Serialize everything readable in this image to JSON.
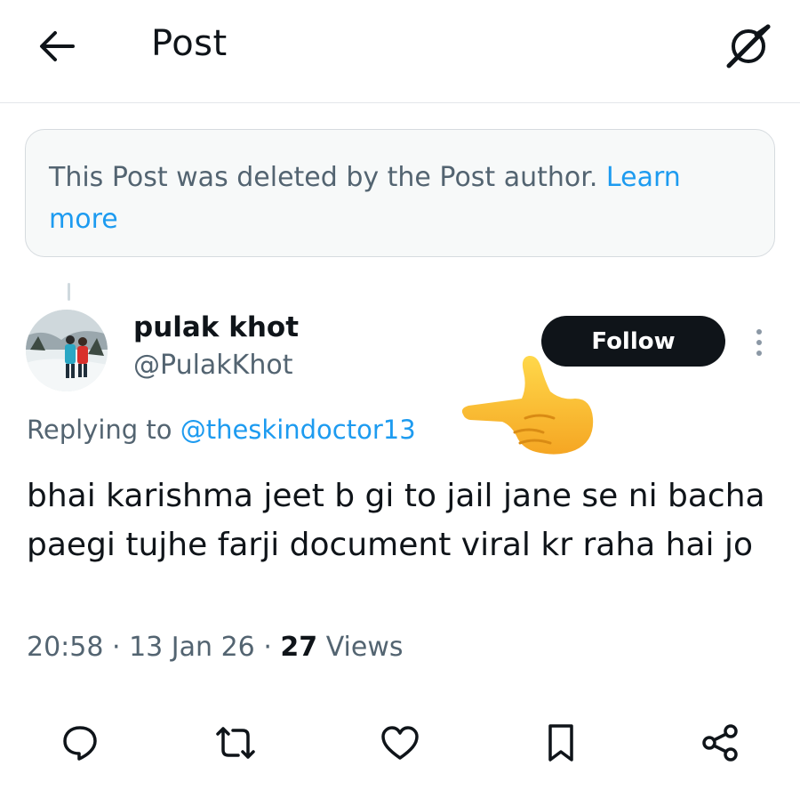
{
  "header": {
    "title": "Post",
    "back_icon": "arrow-left-icon",
    "grok_icon": "grok-icon"
  },
  "notice": {
    "text": "This Post was deleted by the Post author.",
    "link_text": "Learn more"
  },
  "post": {
    "author": {
      "display_name": "pulak khot",
      "handle": "@PulakKhot"
    },
    "follow_label": "Follow",
    "replying_prefix": "Replying to ",
    "replying_to": "@theskindoctor13",
    "text": "bhai karishma jeet b gi to jail jane se ni bacha paegi tujhe farji document viral kr raha hai jo",
    "time": "20:58",
    "date": "13 Jan 26",
    "views_count": "27",
    "views_label": "Views"
  },
  "actions": [
    {
      "icon": "reply-icon"
    },
    {
      "icon": "repost-icon"
    },
    {
      "icon": "like-icon"
    },
    {
      "icon": "bookmark-icon"
    },
    {
      "icon": "share-icon"
    }
  ],
  "colors": {
    "accent": "#1d9bf0",
    "text_primary": "#0f1419",
    "text_secondary": "#536471"
  }
}
